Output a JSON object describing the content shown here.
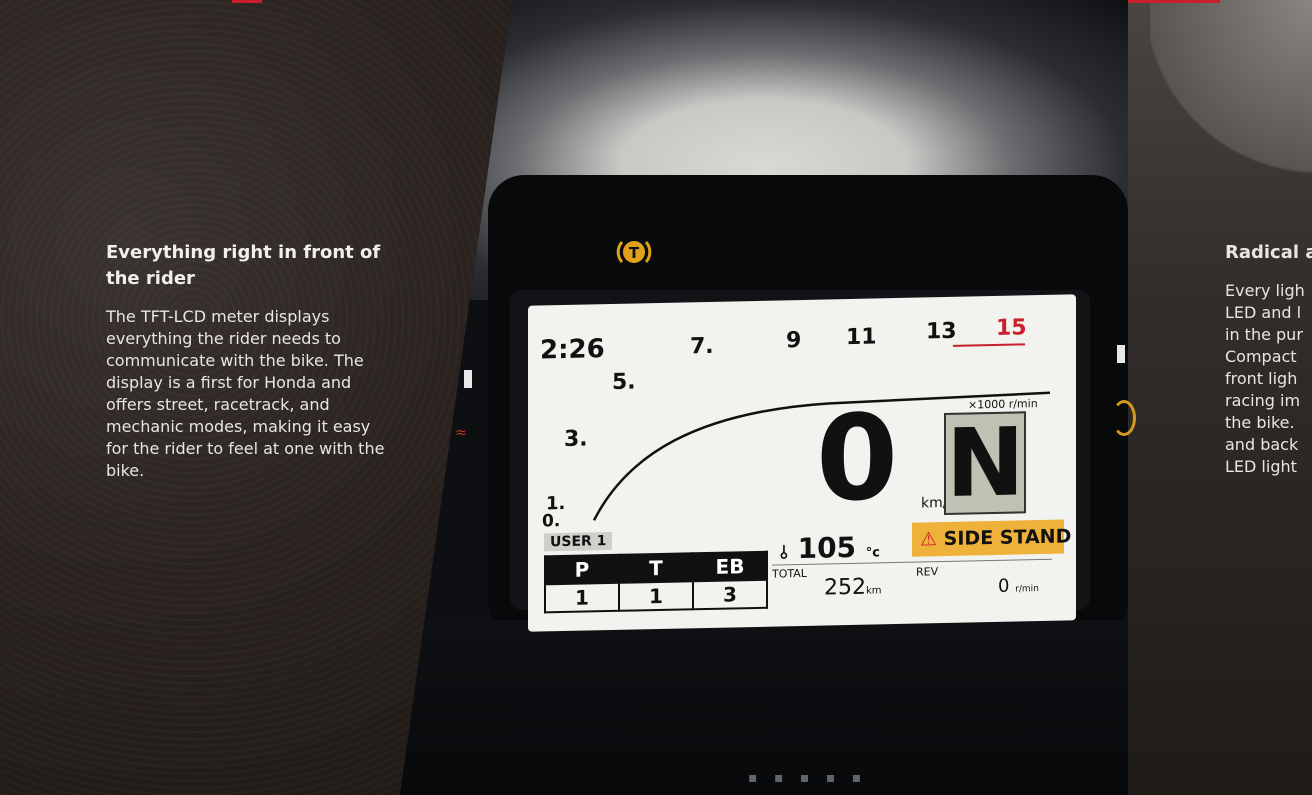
{
  "left_panel": {
    "heading": "Everything right in front of the rider",
    "body": "The TFT-LCD meter displays everything the rider needs to communicate with the bike. The display is a first for Honda and offers street, racetrack, and mechanic modes, making it easy for the rider to feel at one with the bike."
  },
  "right_panel": {
    "heading": "Radical a",
    "lines": [
      "Every ligh",
      "LED and l",
      "in the pur",
      "Compact",
      "front ligh",
      "racing im",
      "the bike.",
      "and back",
      "LED light"
    ]
  },
  "dashboard": {
    "clock": "2:26",
    "tach_ticks": [
      "0.",
      "1.",
      "3.",
      "5.",
      "7.",
      "9",
      "11",
      "13",
      "15"
    ],
    "tach_unit": "×1000 r/min",
    "speed": "0",
    "speed_unit": "km/h",
    "gear": "N",
    "side_stand": "SIDE STAND",
    "user": "USER 1",
    "modes": {
      "headers": [
        "P",
        "T",
        "EB"
      ],
      "values": [
        "1",
        "1",
        "3"
      ]
    },
    "temp": "105",
    "temp_unit": "°c",
    "total_label": "TOTAL",
    "odometer": "252",
    "odometer_unit": "km",
    "rev_label": "REV",
    "rev_value": "0",
    "rev_unit": "r/min"
  },
  "colors": {
    "accent_red": "#c81f2b",
    "stand_amber": "#eeb23a",
    "traction_amber": "#e0a11b"
  },
  "icons": [
    "traction-control-icon",
    "side-stand-icon",
    "coolant-temp-icon",
    "oil-warning-icon"
  ]
}
